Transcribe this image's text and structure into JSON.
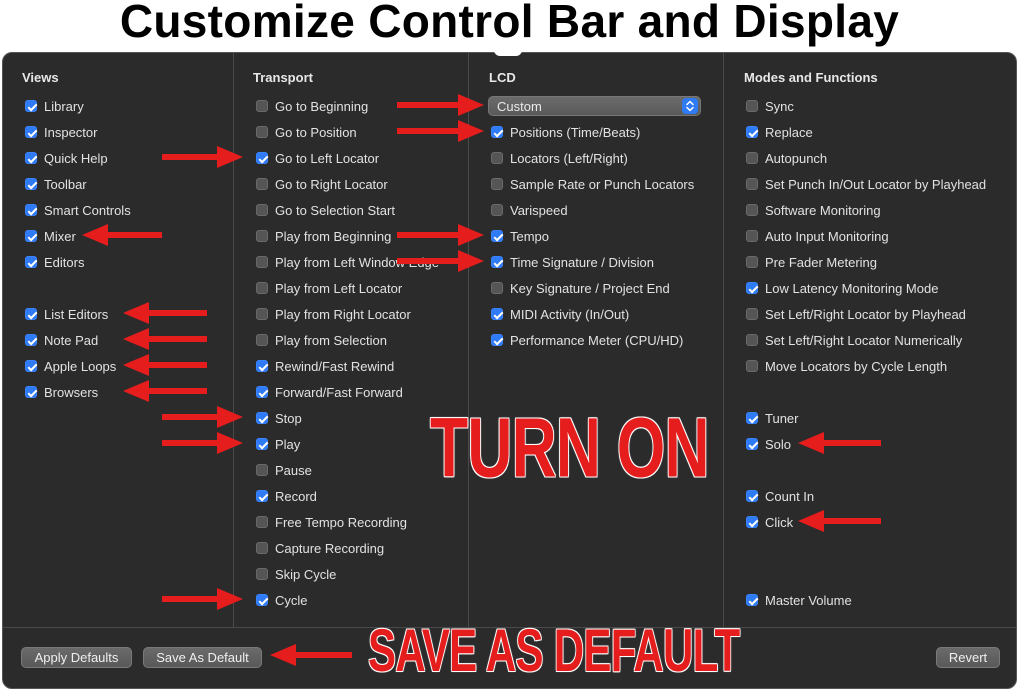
{
  "title": "Customize Control Bar and Display",
  "columns": {
    "views": {
      "heading": "Views",
      "items": [
        {
          "label": "Library",
          "checked": true
        },
        {
          "label": "Inspector",
          "checked": true
        },
        {
          "label": "Quick Help",
          "checked": true
        },
        {
          "label": "Toolbar",
          "checked": true
        },
        {
          "label": "Smart Controls",
          "checked": true
        },
        {
          "label": "Mixer",
          "checked": true
        },
        {
          "label": "Editors",
          "checked": true
        },
        {
          "label": "List Editors",
          "checked": true
        },
        {
          "label": "Note Pad",
          "checked": true
        },
        {
          "label": "Apple Loops",
          "checked": true
        },
        {
          "label": "Browsers",
          "checked": true
        }
      ]
    },
    "transport": {
      "heading": "Transport",
      "items": [
        {
          "label": "Go to Beginning",
          "checked": false
        },
        {
          "label": "Go to Position",
          "checked": false
        },
        {
          "label": "Go to Left Locator",
          "checked": true
        },
        {
          "label": "Go to Right Locator",
          "checked": false
        },
        {
          "label": "Go to Selection Start",
          "checked": false
        },
        {
          "label": "Play from Beginning",
          "checked": false
        },
        {
          "label": "Play from Left Window Edge",
          "checked": false
        },
        {
          "label": "Play from Left Locator",
          "checked": false
        },
        {
          "label": "Play from Right Locator",
          "checked": false
        },
        {
          "label": "Play from Selection",
          "checked": false
        },
        {
          "label": "Rewind/Fast Rewind",
          "checked": true
        },
        {
          "label": "Forward/Fast Forward",
          "checked": true
        },
        {
          "label": "Stop",
          "checked": true
        },
        {
          "label": "Play",
          "checked": true
        },
        {
          "label": "Pause",
          "checked": false
        },
        {
          "label": "Record",
          "checked": true
        },
        {
          "label": "Free Tempo Recording",
          "checked": false
        },
        {
          "label": "Capture Recording",
          "checked": false
        },
        {
          "label": "Skip Cycle",
          "checked": false
        },
        {
          "label": "Cycle",
          "checked": true
        }
      ]
    },
    "lcd": {
      "heading": "LCD",
      "select_value": "Custom",
      "items": [
        {
          "label": "Positions (Time/Beats)",
          "checked": true
        },
        {
          "label": "Locators (Left/Right)",
          "checked": false
        },
        {
          "label": "Sample Rate or Punch Locators",
          "checked": false
        },
        {
          "label": "Varispeed",
          "checked": false
        },
        {
          "label": "Tempo",
          "checked": true
        },
        {
          "label": "Time Signature / Division",
          "checked": true
        },
        {
          "label": "Key Signature / Project End",
          "checked": false
        },
        {
          "label": "MIDI Activity (In/Out)",
          "checked": true
        },
        {
          "label": "Performance Meter (CPU/HD)",
          "checked": true
        }
      ]
    },
    "modes": {
      "heading": "Modes and Functions",
      "items": [
        {
          "label": "Sync",
          "checked": false
        },
        {
          "label": "Replace",
          "checked": true
        },
        {
          "label": "Autopunch",
          "checked": false
        },
        {
          "label": "Set Punch In/Out Locator by Playhead",
          "checked": false
        },
        {
          "label": "Software Monitoring",
          "checked": false
        },
        {
          "label": "Auto Input Monitoring",
          "checked": false
        },
        {
          "label": "Pre Fader Metering",
          "checked": false
        },
        {
          "label": "Low Latency Monitoring Mode",
          "checked": true
        },
        {
          "label": "Set Left/Right Locator by Playhead",
          "checked": false
        },
        {
          "label": "Set Left/Right Locator Numerically",
          "checked": false
        },
        {
          "label": "Move Locators by Cycle Length",
          "checked": false
        },
        {
          "label": "Tuner",
          "checked": true
        },
        {
          "label": "Solo",
          "checked": true
        },
        {
          "label": "Count In",
          "checked": true
        },
        {
          "label": "Click",
          "checked": true
        },
        {
          "label": "Master Volume",
          "checked": true
        }
      ]
    }
  },
  "buttons": {
    "apply_defaults": "Apply Defaults",
    "save_as_default": "Save As Default",
    "revert": "Revert"
  },
  "annotations": {
    "turn_on": "TURN ON",
    "save_as_default": "SAVE AS DEFAULT",
    "color": "#e51d1d"
  },
  "colors": {
    "panel": "#2b2b2b",
    "checkbox_on": "#2f7af5"
  }
}
